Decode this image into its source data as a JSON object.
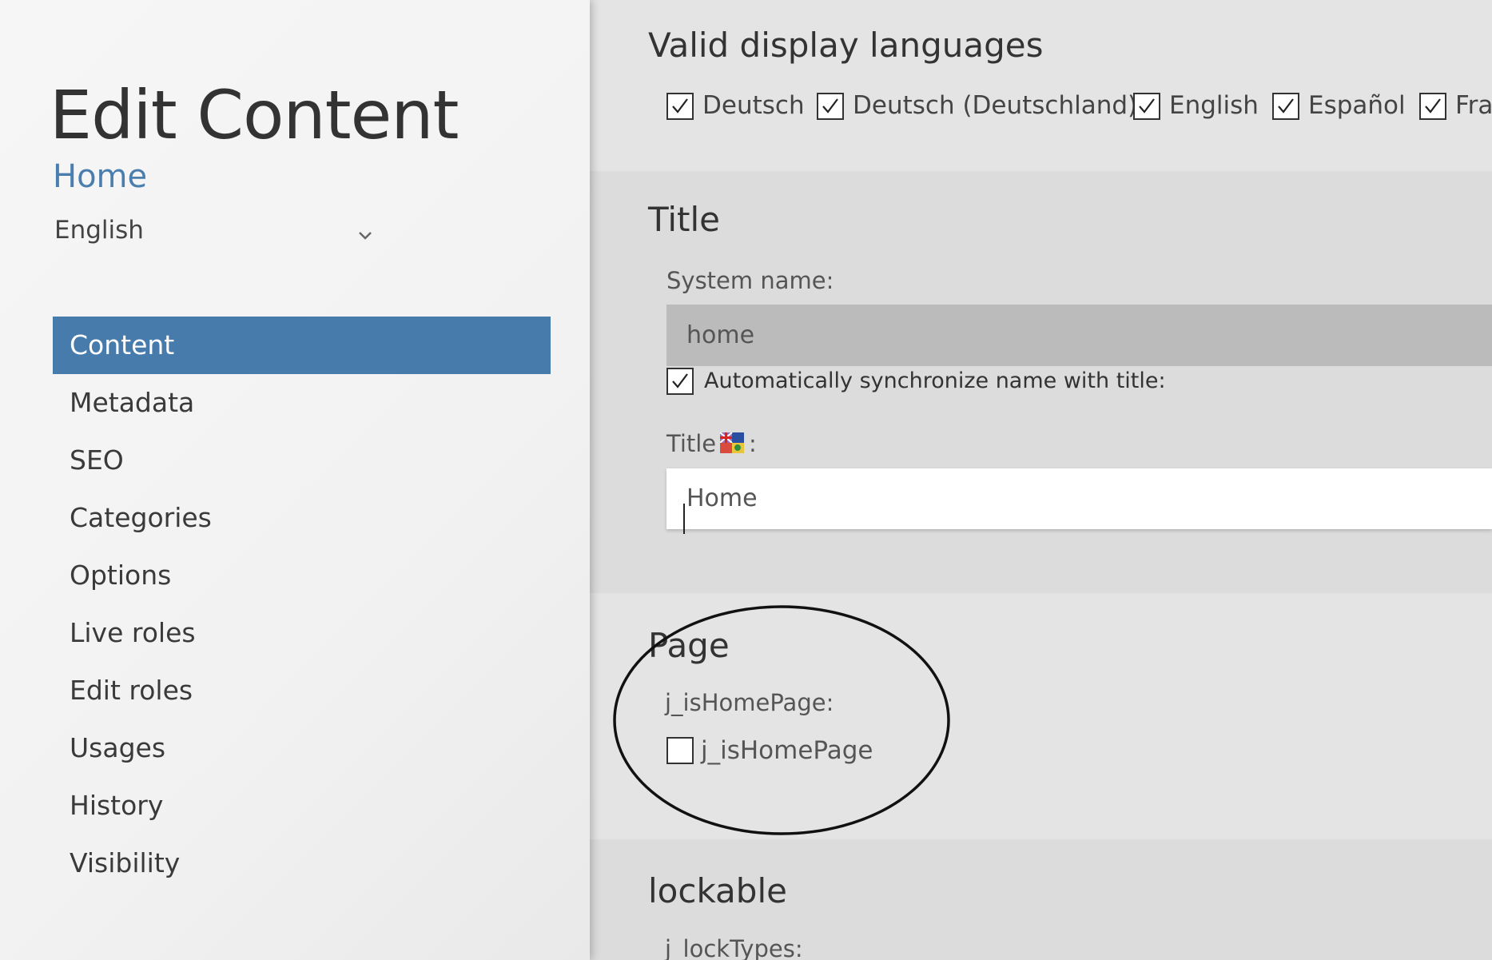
{
  "sidebar": {
    "title": "Edit Content",
    "subtitle": "Home",
    "language": {
      "selected": "English",
      "icon": "chevron-down-icon"
    },
    "nav": [
      {
        "label": "Content",
        "active": true
      },
      {
        "label": "Metadata"
      },
      {
        "label": "SEO"
      },
      {
        "label": "Categories"
      },
      {
        "label": "Options"
      },
      {
        "label": "Live roles"
      },
      {
        "label": "Edit roles"
      },
      {
        "label": "Usages"
      },
      {
        "label": "History"
      },
      {
        "label": "Visibility"
      }
    ]
  },
  "main": {
    "languages": {
      "heading": "Valid display languages",
      "options": [
        {
          "label": "Deutsch",
          "checked": true
        },
        {
          "label": "Deutsch (Deutschland)",
          "checked": true
        },
        {
          "label": "English",
          "checked": true
        },
        {
          "label": "Español",
          "checked": true
        },
        {
          "label": "Fra",
          "checked": true
        }
      ]
    },
    "title_section": {
      "heading": "Title",
      "system_name_label": "System name:",
      "system_name_value": "home",
      "sync_label": "Automatically synchronize name with title:",
      "sync_checked": true,
      "title_label": "Title",
      "title_suffix": ":",
      "title_value": "Home",
      "flag_icon": "uk-flag-icon"
    },
    "page_section": {
      "heading": "Page",
      "field_label": "j_isHomePage:",
      "checkbox_label": "j_isHomePage",
      "checked": false
    },
    "lock_section": {
      "heading": "lockable",
      "field_label": "j_lockTypes:"
    }
  },
  "colors": {
    "accent": "#467bab",
    "subtitle": "#4a7eae",
    "sidebar_bg": "#f4f4f4",
    "section_light": "#e4e4e4",
    "section_dark": "#dcdcdc",
    "readonly_field": "#bbbbbb"
  }
}
